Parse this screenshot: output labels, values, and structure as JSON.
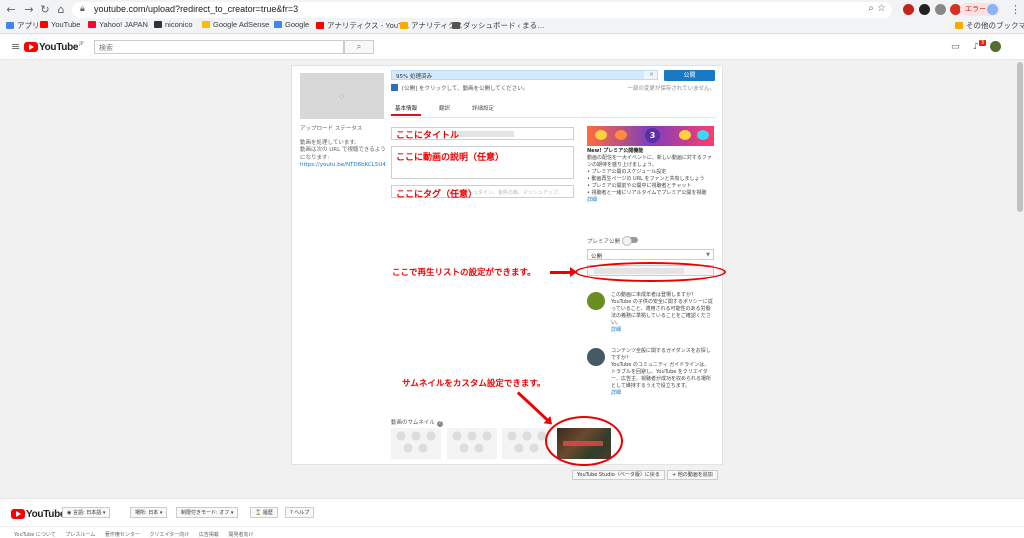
{
  "browser": {
    "url": "youtube.com/upload?redirect_to_creator=true&fr=3",
    "error_label": "エラー",
    "bookmarks": [
      {
        "label": "アプリ",
        "color": "#4285f4"
      },
      {
        "label": "YouTube",
        "color": "#ff0000"
      },
      {
        "label": "Yahoo! JAPAN",
        "color": "#ff0033"
      },
      {
        "label": "niconico",
        "color": "#333333"
      },
      {
        "label": "Google AdSense",
        "color": "#fbbc04"
      },
      {
        "label": "Google",
        "color": "#4285f4"
      },
      {
        "label": "アナリティクス - YouT…",
        "color": "#ff0000"
      },
      {
        "label": "アナリティクス",
        "color": "#f9ab00"
      },
      {
        "label": "ダッシュボード ‹ まる…",
        "color": "#555555"
      },
      {
        "label": "その他のブックマーク",
        "color": "#f9ab00"
      }
    ]
  },
  "header": {
    "logo_text": "YouTube",
    "logo_sup": "JP",
    "search_placeholder": "検索"
  },
  "upload": {
    "progress_text": "95% 処理済み",
    "progress_percent": 95,
    "publish_label": "公開",
    "hint_text": "[公開] をクリックして、動画を公開してください。",
    "saved_text": "一部の変更が保存されていません。",
    "tabs": [
      "基本情報",
      "翻訳",
      "詳細設定"
    ],
    "left_status_label": "アップロード ステータス",
    "left_status_processing": "動画を処理しています。",
    "left_status_url_note": "動画は次の URL で視聴できるようになります:",
    "left_status_url": "https://youtu.be/NTD6bKCL5U4",
    "overlay_title": "ここにタイトル",
    "overlay_desc": "ここに動画の説明（任意）",
    "overlay_tags": "ここにタグ（任意）",
    "tags_placeholder": "シュタイン、金魚の餌、マッシュアップ、",
    "thumbnail_label": "動画のサムネイル",
    "studio_button": "YouTube Studio（ベータ版）に戻る",
    "add_more_button": "+ 他の動画を追加"
  },
  "premiere": {
    "promo_number": "3",
    "title": "New! プレミア公開機能",
    "desc": "動画の配信を一大イベントに、新しい動画に対するファンの期待を盛り上げましょう。",
    "bullets": [
      "• プレミア公開のスケジュール設定",
      "• 動画再生ページの URL をファンと共有しましょう",
      "• プレミア公開前や公開中に視聴者とチャット",
      "• 視聴者と一緒にリアルタイムでプレミア公開を視聴"
    ],
    "detail_link": "詳細",
    "premiere_label": "プレミア公開",
    "visibility_value": "公開"
  },
  "info_blocks": [
    {
      "text": "この動画に未成年者は登場しますか？",
      "body": "YouTube の子供の安全に関するポリシーに従っていること、適用される可能性のある労働法の義務に準拠していることをご確認ください。",
      "link": "詳細",
      "icon_color": "#6b8e23"
    },
    {
      "text": "コンテンツ全般に関するガイダンスをお探しですか？",
      "body": "YouTube のコミュニティ ガイドラインは、トラブルを回避し、YouTube をクリエイター、広告主、視聴者が成功を収められる場所として維持するうえで役立ちます。",
      "link": "詳細",
      "icon_color": "#455a64"
    }
  ],
  "annotations": {
    "playlist_note": "ここで再生リストの設定ができます。",
    "thumbnail_note": "サムネイルをカスタム設定できます。",
    "color": "#ee0000"
  },
  "footer": {
    "logo_text": "YouTube",
    "buttons": [
      "言語: 日本語 ▾",
      "場所: 日本 ▾",
      "制限付きモード: オフ ▾",
      "履歴",
      "ヘルプ"
    ],
    "links": [
      "YouTube について",
      "プレスルーム",
      "著作権センター",
      "クリエイター向け",
      "広告掲載",
      "開発者向け"
    ]
  }
}
